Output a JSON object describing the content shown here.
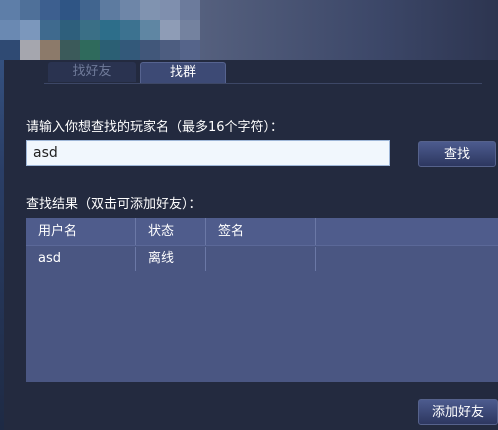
{
  "tabs": [
    {
      "label": "找好友",
      "active": false
    },
    {
      "label": "找群",
      "active": true
    }
  ],
  "search": {
    "prompt": "请输入你想查找的玩家名（最多16个字符）：",
    "value": "asd",
    "button_label": "查找"
  },
  "results": {
    "title": "查找结果（双击可添加好友）：",
    "columns": [
      "用户名",
      "状态",
      "签名"
    ],
    "rows": [
      {
        "username": "asd",
        "status": "离线",
        "signature": ""
      }
    ]
  },
  "actions": {
    "add_friend_label": "添加好友"
  },
  "colors": {
    "background": "#232a3f",
    "panel": "#4a5682",
    "header": "#4f5c8c",
    "input_bg": "#f1f7fd",
    "active_tab": "#3d4a75"
  }
}
